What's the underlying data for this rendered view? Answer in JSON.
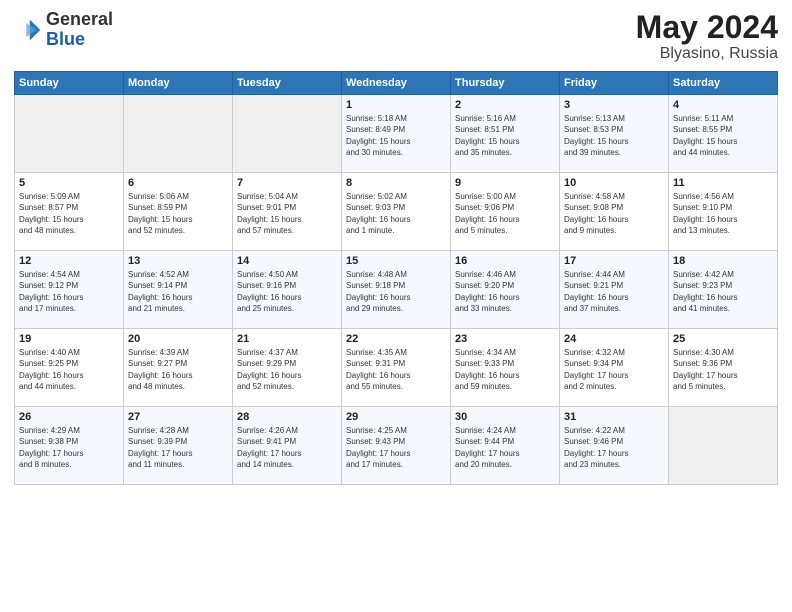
{
  "header": {
    "logo": {
      "line1": "General",
      "line2": "Blue"
    },
    "title": "May 2024",
    "subtitle": "Blyasino, Russia"
  },
  "days_of_week": [
    "Sunday",
    "Monday",
    "Tuesday",
    "Wednesday",
    "Thursday",
    "Friday",
    "Saturday"
  ],
  "weeks": [
    [
      {
        "day": "",
        "content": ""
      },
      {
        "day": "",
        "content": ""
      },
      {
        "day": "",
        "content": ""
      },
      {
        "day": "1",
        "content": "Sunrise: 5:18 AM\nSunset: 8:49 PM\nDaylight: 15 hours\nand 30 minutes."
      },
      {
        "day": "2",
        "content": "Sunrise: 5:16 AM\nSunset: 8:51 PM\nDaylight: 15 hours\nand 35 minutes."
      },
      {
        "day": "3",
        "content": "Sunrise: 5:13 AM\nSunset: 8:53 PM\nDaylight: 15 hours\nand 39 minutes."
      },
      {
        "day": "4",
        "content": "Sunrise: 5:11 AM\nSunset: 8:55 PM\nDaylight: 15 hours\nand 44 minutes."
      }
    ],
    [
      {
        "day": "5",
        "content": "Sunrise: 5:09 AM\nSunset: 8:57 PM\nDaylight: 15 hours\nand 48 minutes."
      },
      {
        "day": "6",
        "content": "Sunrise: 5:06 AM\nSunset: 8:59 PM\nDaylight: 15 hours\nand 52 minutes."
      },
      {
        "day": "7",
        "content": "Sunrise: 5:04 AM\nSunset: 9:01 PM\nDaylight: 15 hours\nand 57 minutes."
      },
      {
        "day": "8",
        "content": "Sunrise: 5:02 AM\nSunset: 9:03 PM\nDaylight: 16 hours\nand 1 minute."
      },
      {
        "day": "9",
        "content": "Sunrise: 5:00 AM\nSunset: 9:06 PM\nDaylight: 16 hours\nand 5 minutes."
      },
      {
        "day": "10",
        "content": "Sunrise: 4:58 AM\nSunset: 9:08 PM\nDaylight: 16 hours\nand 9 minutes."
      },
      {
        "day": "11",
        "content": "Sunrise: 4:56 AM\nSunset: 9:10 PM\nDaylight: 16 hours\nand 13 minutes."
      }
    ],
    [
      {
        "day": "12",
        "content": "Sunrise: 4:54 AM\nSunset: 9:12 PM\nDaylight: 16 hours\nand 17 minutes."
      },
      {
        "day": "13",
        "content": "Sunrise: 4:52 AM\nSunset: 9:14 PM\nDaylight: 16 hours\nand 21 minutes."
      },
      {
        "day": "14",
        "content": "Sunrise: 4:50 AM\nSunset: 9:16 PM\nDaylight: 16 hours\nand 25 minutes."
      },
      {
        "day": "15",
        "content": "Sunrise: 4:48 AM\nSunset: 9:18 PM\nDaylight: 16 hours\nand 29 minutes."
      },
      {
        "day": "16",
        "content": "Sunrise: 4:46 AM\nSunset: 9:20 PM\nDaylight: 16 hours\nand 33 minutes."
      },
      {
        "day": "17",
        "content": "Sunrise: 4:44 AM\nSunset: 9:21 PM\nDaylight: 16 hours\nand 37 minutes."
      },
      {
        "day": "18",
        "content": "Sunrise: 4:42 AM\nSunset: 9:23 PM\nDaylight: 16 hours\nand 41 minutes."
      }
    ],
    [
      {
        "day": "19",
        "content": "Sunrise: 4:40 AM\nSunset: 9:25 PM\nDaylight: 16 hours\nand 44 minutes."
      },
      {
        "day": "20",
        "content": "Sunrise: 4:39 AM\nSunset: 9:27 PM\nDaylight: 16 hours\nand 48 minutes."
      },
      {
        "day": "21",
        "content": "Sunrise: 4:37 AM\nSunset: 9:29 PM\nDaylight: 16 hours\nand 52 minutes."
      },
      {
        "day": "22",
        "content": "Sunrise: 4:35 AM\nSunset: 9:31 PM\nDaylight: 16 hours\nand 55 minutes."
      },
      {
        "day": "23",
        "content": "Sunrise: 4:34 AM\nSunset: 9:33 PM\nDaylight: 16 hours\nand 59 minutes."
      },
      {
        "day": "24",
        "content": "Sunrise: 4:32 AM\nSunset: 9:34 PM\nDaylight: 17 hours\nand 2 minutes."
      },
      {
        "day": "25",
        "content": "Sunrise: 4:30 AM\nSunset: 9:36 PM\nDaylight: 17 hours\nand 5 minutes."
      }
    ],
    [
      {
        "day": "26",
        "content": "Sunrise: 4:29 AM\nSunset: 9:38 PM\nDaylight: 17 hours\nand 8 minutes."
      },
      {
        "day": "27",
        "content": "Sunrise: 4:28 AM\nSunset: 9:39 PM\nDaylight: 17 hours\nand 11 minutes."
      },
      {
        "day": "28",
        "content": "Sunrise: 4:26 AM\nSunset: 9:41 PM\nDaylight: 17 hours\nand 14 minutes."
      },
      {
        "day": "29",
        "content": "Sunrise: 4:25 AM\nSunset: 9:43 PM\nDaylight: 17 hours\nand 17 minutes."
      },
      {
        "day": "30",
        "content": "Sunrise: 4:24 AM\nSunset: 9:44 PM\nDaylight: 17 hours\nand 20 minutes."
      },
      {
        "day": "31",
        "content": "Sunrise: 4:22 AM\nSunset: 9:46 PM\nDaylight: 17 hours\nand 23 minutes."
      },
      {
        "day": "",
        "content": ""
      }
    ]
  ]
}
